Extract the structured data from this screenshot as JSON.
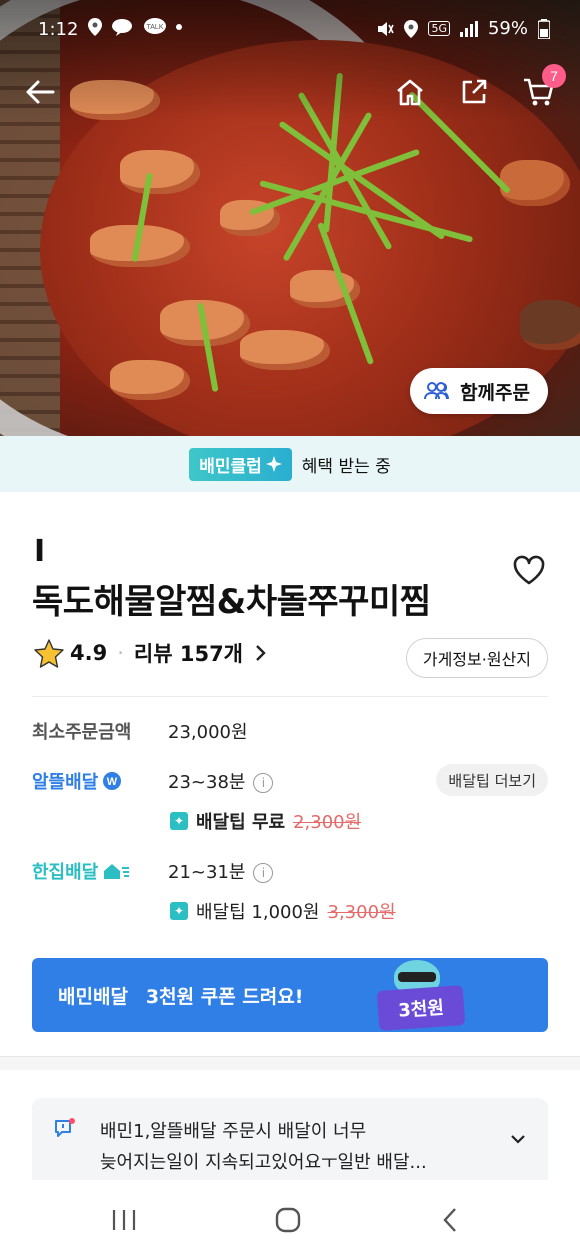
{
  "status_bar": {
    "time": "1:12",
    "battery": "59%",
    "network": "5G"
  },
  "top_nav": {
    "cart_count": "7"
  },
  "hero": {
    "group_order_label": "함께주문"
  },
  "club_banner": {
    "tag": "배민클럽",
    "text": "혜택 받는 중"
  },
  "store": {
    "prefix": "I",
    "name": "독도해물알찜&차돌쭈꾸미찜",
    "rating": "4.9",
    "review_label": "리뷰 157개",
    "info_button": "가게정보·원산지"
  },
  "order_info": {
    "min_order_label": "최소주문금액",
    "min_order_value": "23,000원",
    "saver_delivery_label": "알뜰배달",
    "saver_delivery_time": "23~38분",
    "tip_more_button": "배달팁 더보기",
    "saver_tip_label": "배달팁 무료",
    "saver_tip_original": "2,300원",
    "single_delivery_label": "한집배달",
    "single_delivery_time": "21~31분",
    "single_tip_label": "배달팁 1,000원",
    "single_tip_original": "3,300원"
  },
  "coupon_banner": {
    "brand": "배민배달",
    "text": "3천원 쿠폰 드려요!",
    "ticket": "3천원"
  },
  "notice": {
    "line1": "배민1,알뜰배달 주문시 배달이 너무",
    "line2": "늦어지는일이 지속되고있어요ㅜ일반 배달..."
  },
  "colors": {
    "accent_blue": "#2f7fe6",
    "club_teal": "#2bbfc4",
    "cart_badge": "#ff5c8a",
    "strike_red": "#e56b6b"
  },
  "icons": [
    "back-arrow-icon",
    "home-icon",
    "share-icon",
    "cart-icon",
    "people-icon",
    "heart-icon",
    "star-icon",
    "chevron-right-icon",
    "info-icon",
    "notice-icon",
    "chevron-down-icon"
  ]
}
